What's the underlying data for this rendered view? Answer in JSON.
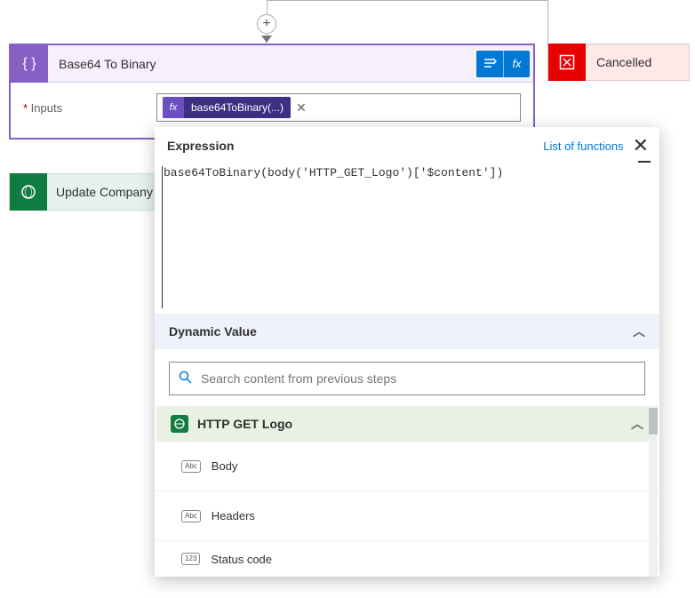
{
  "connector": {
    "add": "+"
  },
  "action": {
    "title": "Base64 To Binary",
    "param_label": "Inputs",
    "token": {
      "fx": "fx",
      "label": "base64ToBinary(...)"
    }
  },
  "cancelled": {
    "title": "Cancelled"
  },
  "update": {
    "title": "Update Company"
  },
  "popup": {
    "expression_label": "Expression",
    "list_link": "List of functions",
    "code": "base64ToBinary(body('HTTP_GET_Logo')['$content'])",
    "dynamic_label": "Dynamic Value",
    "search_placeholder": "Search content from previous steps",
    "source_label": "HTTP GET Logo",
    "items": [
      {
        "badge": "Abc",
        "label": "Body"
      },
      {
        "badge": "Abc",
        "label": "Headers"
      },
      {
        "badge": "123",
        "label": "Status code"
      }
    ]
  }
}
